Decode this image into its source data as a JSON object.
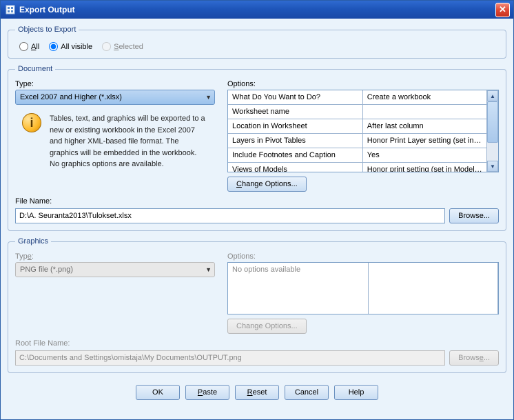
{
  "window": {
    "title": "Export Output",
    "close_glyph": "✕"
  },
  "objects": {
    "legend": "Objects to Export",
    "all_label_pre": "A",
    "all_label_post": "ll",
    "all_visible_label": "All visible",
    "selected_label_pre": "S",
    "selected_label_post": "elected"
  },
  "document": {
    "legend": "Document",
    "type_label": "Type:",
    "type_value": "Excel 2007 and Higher (*.xlsx)",
    "info_text": "Tables, text, and graphics will be exported to a new or existing workbook in the Excel 2007 and higher XML-based file format. The graphics will be embedded in the workbook. No graphics options are available.",
    "options_label": "Options:",
    "options_rows": [
      {
        "k": "What Do You Want to Do?",
        "v": "Create a workbook"
      },
      {
        "k": "Worksheet name",
        "v": ""
      },
      {
        "k": "Location in Worksheet",
        "v": "After last column"
      },
      {
        "k": "Layers in Pivot Tables",
        "v": "Honor Print Layer setting (set in Tabl..."
      },
      {
        "k": "Include Footnotes and Caption",
        "v": "Yes"
      },
      {
        "k": "Views of Models",
        "v": "Honor print setting (set in Model Vie..."
      }
    ],
    "change_options_pre": "C",
    "change_options_post": "hange Options...",
    "file_name_label": "File Name:",
    "file_name_value": "D:\\A. Seuranta2013\\Tulokset.xlsx",
    "browse_label": "Browse..."
  },
  "graphics": {
    "legend": "Graphics",
    "type_label_pre": "Typ",
    "type_label_post": ":",
    "type_label_e": "e",
    "type_value": "PNG file (*.png)",
    "options_label": "Options:",
    "no_options": "No options available",
    "change_options_label": "Change Options...",
    "root_file_name_label": "Root File Name:",
    "root_file_name_value": "C:\\Documents and Settings\\omistaja\\My Documents\\OUTPUT.png",
    "browse_label_pre": "Brows",
    "browse_label_e": "e",
    "browse_label_post": "..."
  },
  "buttons": {
    "ok": "OK",
    "paste_p": "P",
    "paste_rest": "aste",
    "reset_r": "R",
    "reset_rest": "eset",
    "cancel": "Cancel",
    "help": "Help"
  }
}
